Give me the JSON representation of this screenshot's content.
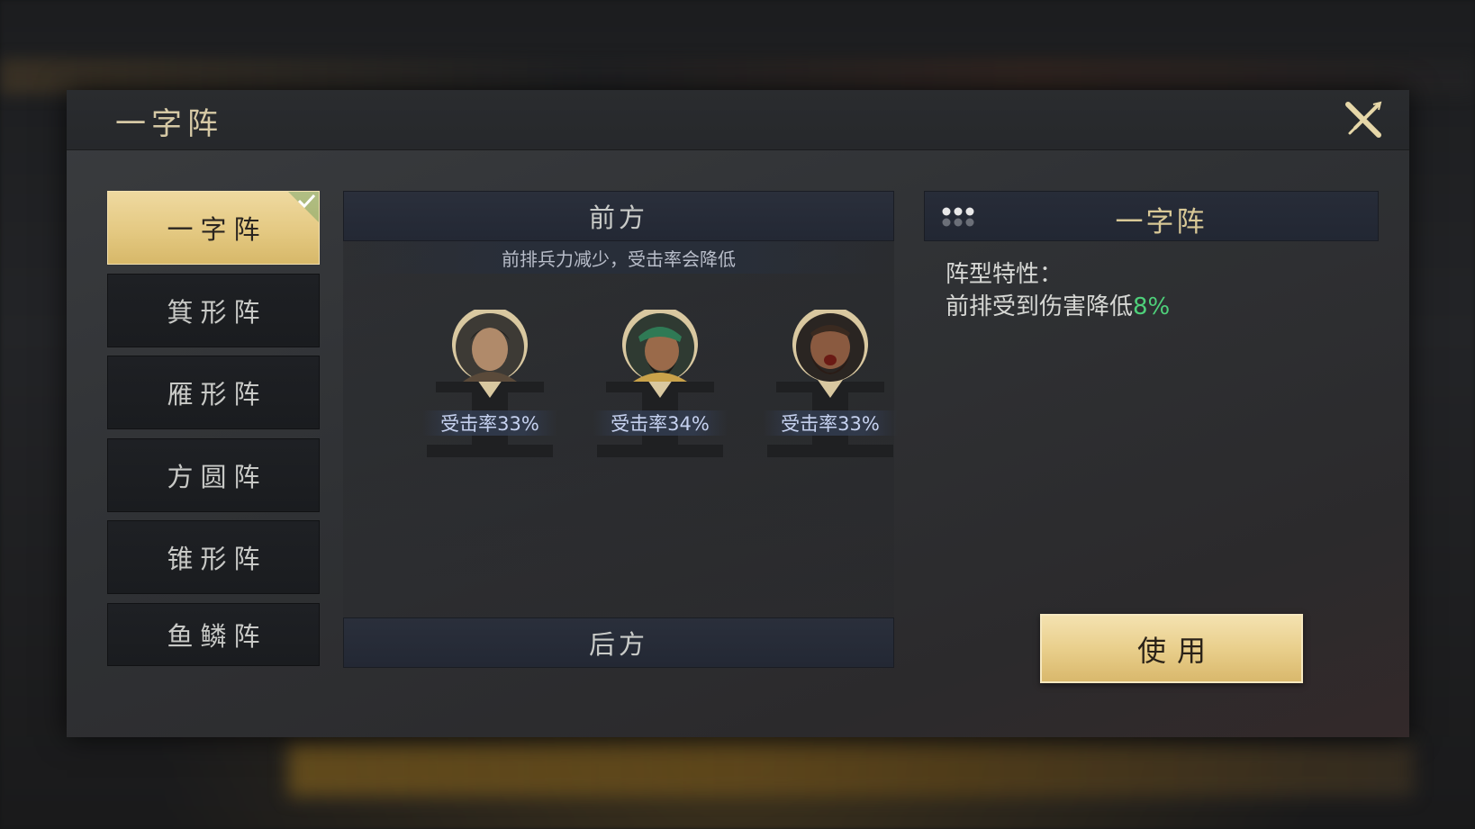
{
  "dialog": {
    "title": "一字阵"
  },
  "formations": [
    {
      "label": "一字阵",
      "selected": true
    },
    {
      "label": "箕形阵",
      "selected": false
    },
    {
      "label": "雁形阵",
      "selected": false
    },
    {
      "label": "方圆阵",
      "selected": false
    },
    {
      "label": "锥形阵",
      "selected": false
    },
    {
      "label": "鱼鳞阵",
      "selected": false
    }
  ],
  "front": {
    "title": "前方",
    "note": "前排兵力减少，受击率会降低",
    "slots": [
      {
        "hit_rate": "受击率33%"
      },
      {
        "hit_rate": "受击率34%"
      },
      {
        "hit_rate": "受击率33%"
      }
    ]
  },
  "rear": {
    "title": "后方"
  },
  "detail": {
    "title": "一字阵",
    "trait_label": "阵型特性：",
    "trait_text": "前排受到伤害降低",
    "trait_value": "8%",
    "use_label": "使用"
  },
  "colors": {
    "gold": "#e4c982",
    "highlight_green": "#4ed07a",
    "title_gold": "#d8c896"
  }
}
